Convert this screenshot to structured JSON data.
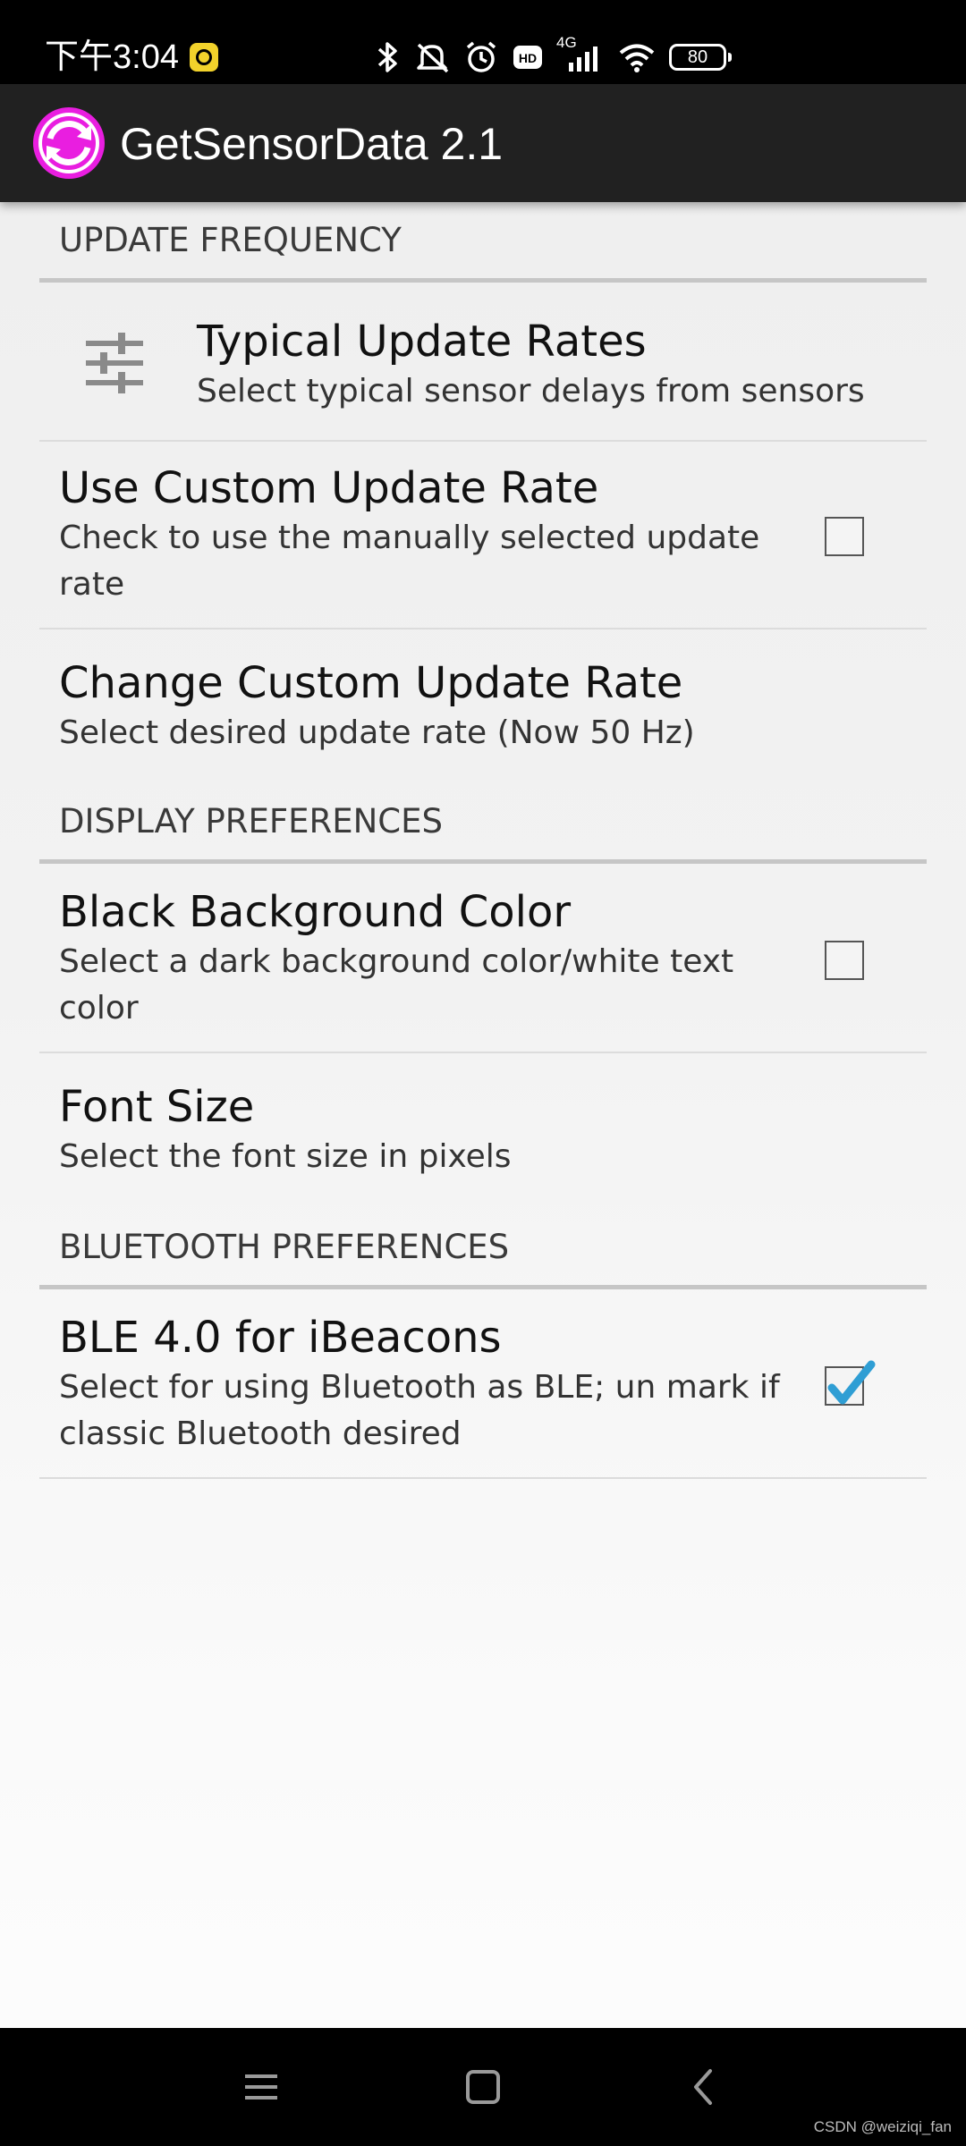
{
  "status_bar": {
    "time": "下午3:04",
    "network": "4G",
    "battery": "80"
  },
  "app_bar": {
    "title": "GetSensorData 2.1",
    "icon_colors": [
      "#e91ee0",
      "#ffffff"
    ]
  },
  "sections": {
    "update_frequency": {
      "title": "UPDATE FREQUENCY",
      "typical_rates": {
        "title": "Typical Update Rates",
        "summary": "Select typical sensor delays from sensors",
        "icon": "tune-icon"
      },
      "use_custom_rate": {
        "title": "Use Custom Update Rate",
        "summary": "Check to use the manually selected update rate",
        "checked": false
      },
      "change_custom_rate": {
        "title": "Change Custom Update Rate",
        "summary": "Select desired update rate (Now 50 Hz)"
      }
    },
    "display_preferences": {
      "title": "DISPLAY PREFERENCES",
      "black_background": {
        "title": "Black Background Color",
        "summary": "Select a dark background color/white text color",
        "checked": false
      },
      "font_size": {
        "title": "Font Size",
        "summary": "Select the font size in pixels"
      }
    },
    "bluetooth_preferences": {
      "title": "BLUETOOTH PREFERENCES",
      "ble_ibeacons": {
        "title": "BLE 4.0 for iBeacons",
        "summary": "Select for using Bluetooth as BLE; un mark if classic Bluetooth desired",
        "checked": true,
        "check_color": "#2f9ed4"
      }
    }
  },
  "nav_bar": {
    "icons": [
      "menu-icon",
      "home-icon",
      "back-icon"
    ]
  },
  "watermark": "CSDN @weiziqi_fan"
}
